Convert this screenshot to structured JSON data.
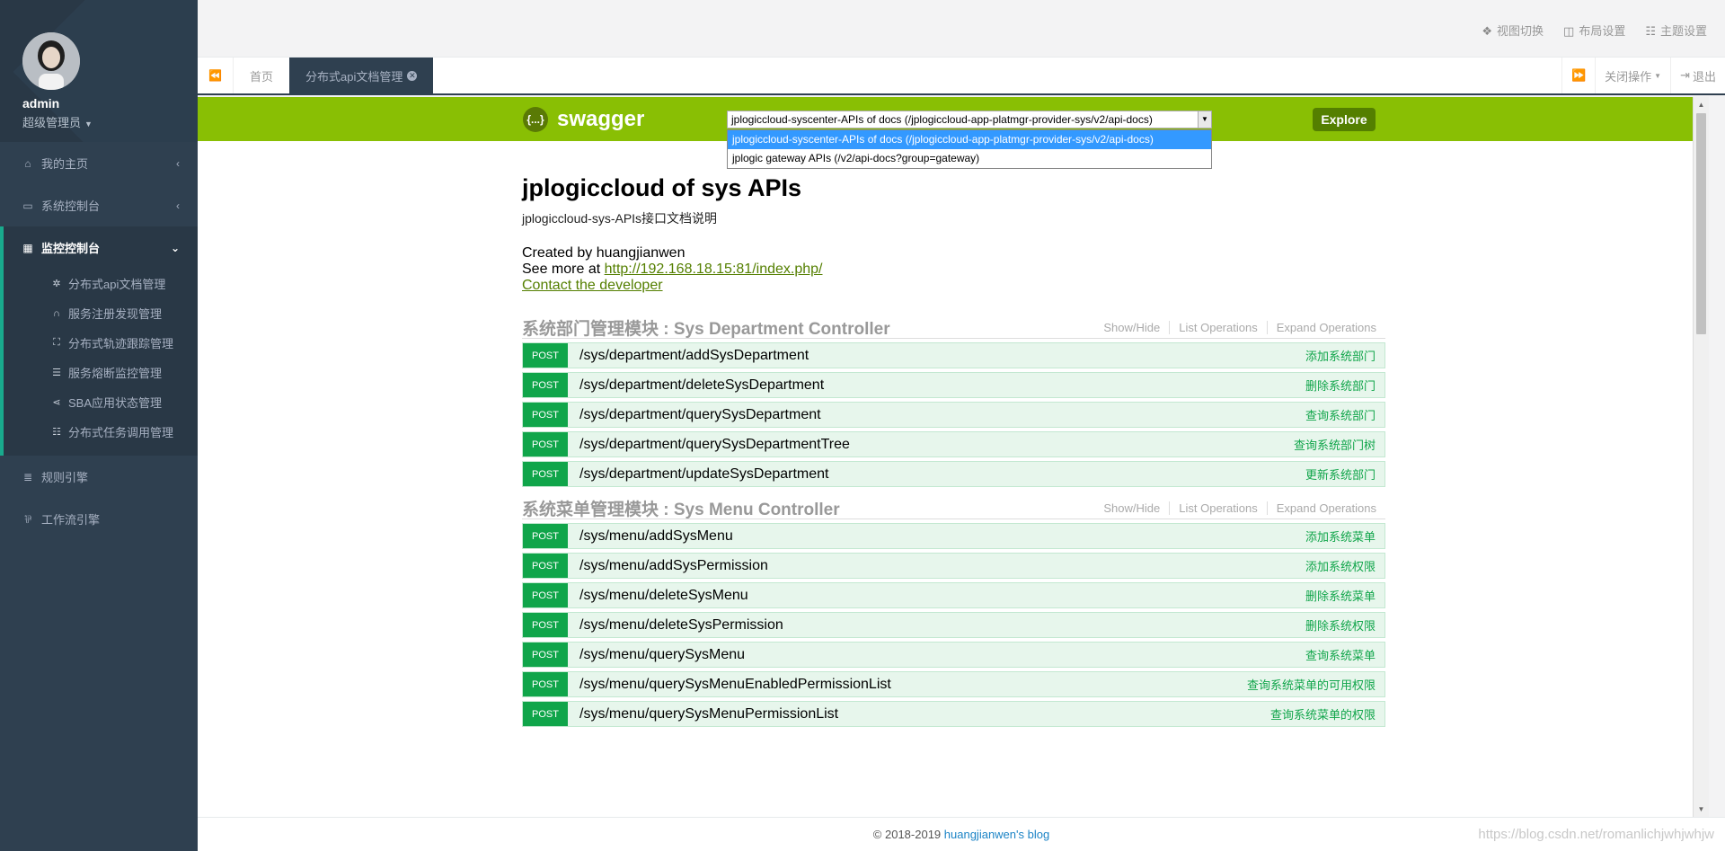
{
  "sidebar": {
    "username": "admin",
    "role": "超级管理员",
    "menu": [
      {
        "label": "我的主页",
        "icon": "home-icon"
      },
      {
        "label": "系统控制台",
        "icon": "desktop-icon"
      }
    ],
    "active_group": {
      "label": "监控控制台",
      "icon": "dashboard-icon",
      "items": [
        {
          "label": "分布式api文档管理",
          "icon": "gear-icon"
        },
        {
          "label": "服务注册发现管理",
          "icon": "binoculars-icon"
        },
        {
          "label": "分布式轨迹跟踪管理",
          "icon": "expand-icon"
        },
        {
          "label": "服务熔断监控管理",
          "icon": "list-icon"
        },
        {
          "label": "SBA应用状态管理",
          "icon": "share-icon"
        },
        {
          "label": "分布式任务调用管理",
          "icon": "tasks-icon"
        }
      ]
    },
    "bottom_menu": [
      {
        "label": "规则引擎",
        "icon": "database-icon"
      },
      {
        "label": "工作流引擎",
        "icon": "workflow-icon"
      }
    ]
  },
  "topbar": {
    "view_switch": "视图切换",
    "layout_settings": "布局设置",
    "theme_settings": "主题设置"
  },
  "tabs": {
    "home": "首页",
    "active": "分布式api文档管理",
    "close_ops": "关闭操作",
    "logout": "退出"
  },
  "swagger": {
    "logo_text": "swagger",
    "logo_symbol": "{...}",
    "selected_spec": "jplogiccloud-syscenter-APIs of docs (/jplogiccloud-app-platmgr-provider-sys/v2/api-docs)",
    "explore_label": "Explore",
    "spec_options": [
      "jplogiccloud-syscenter-APIs of docs (/jplogiccloud-app-platmgr-provider-sys/v2/api-docs)",
      "jplogic gateway APIs (/v2/api-docs?group=gateway)"
    ],
    "title": "jplogiccloud of sys APIs",
    "description": "jplogiccloud-sys-APIs接口文档说明",
    "created_by": "Created by huangjianwen",
    "see_more_prefix": "See more at ",
    "see_more_link": "http://192.168.18.15:81/index.php/",
    "contact": "Contact the developer",
    "ops_labels": {
      "show_hide": "Show/Hide",
      "list_ops": "List Operations",
      "expand_ops": "Expand Operations"
    },
    "resources": [
      {
        "title": "系统部门管理模块 : Sys Department Controller",
        "operations": [
          {
            "method": "POST",
            "path": "/sys/department/addSysDepartment",
            "summary": "添加系统部门"
          },
          {
            "method": "POST",
            "path": "/sys/department/deleteSysDepartment",
            "summary": "删除系统部门"
          },
          {
            "method": "POST",
            "path": "/sys/department/querySysDepartment",
            "summary": "查询系统部门"
          },
          {
            "method": "POST",
            "path": "/sys/department/querySysDepartmentTree",
            "summary": "查询系统部门树"
          },
          {
            "method": "POST",
            "path": "/sys/department/updateSysDepartment",
            "summary": "更新系统部门"
          }
        ]
      },
      {
        "title": "系统菜单管理模块 : Sys Menu Controller",
        "operations": [
          {
            "method": "POST",
            "path": "/sys/menu/addSysMenu",
            "summary": "添加系统菜单"
          },
          {
            "method": "POST",
            "path": "/sys/menu/addSysPermission",
            "summary": "添加系统权限"
          },
          {
            "method": "POST",
            "path": "/sys/menu/deleteSysMenu",
            "summary": "删除系统菜单"
          },
          {
            "method": "POST",
            "path": "/sys/menu/deleteSysPermission",
            "summary": "删除系统权限"
          },
          {
            "method": "POST",
            "path": "/sys/menu/querySysMenu",
            "summary": "查询系统菜单"
          },
          {
            "method": "POST",
            "path": "/sys/menu/querySysMenuEnabledPermissionList",
            "summary": "查询系统菜单的可用权限"
          },
          {
            "method": "POST",
            "path": "/sys/menu/querySysMenuPermissionList",
            "summary": "查询系统菜单的权限"
          }
        ]
      }
    ]
  },
  "footer": {
    "copyright": "© 2018-2019 ",
    "blog_link": "huangjianwen's blog",
    "watermark": "https://blog.csdn.net/romanlichjwhjwhjw"
  },
  "colors": {
    "sidebar_bg": "#2f4050",
    "accent": "#19aa8d",
    "swagger_green": "#89bf04",
    "post_green": "#10a54a"
  }
}
